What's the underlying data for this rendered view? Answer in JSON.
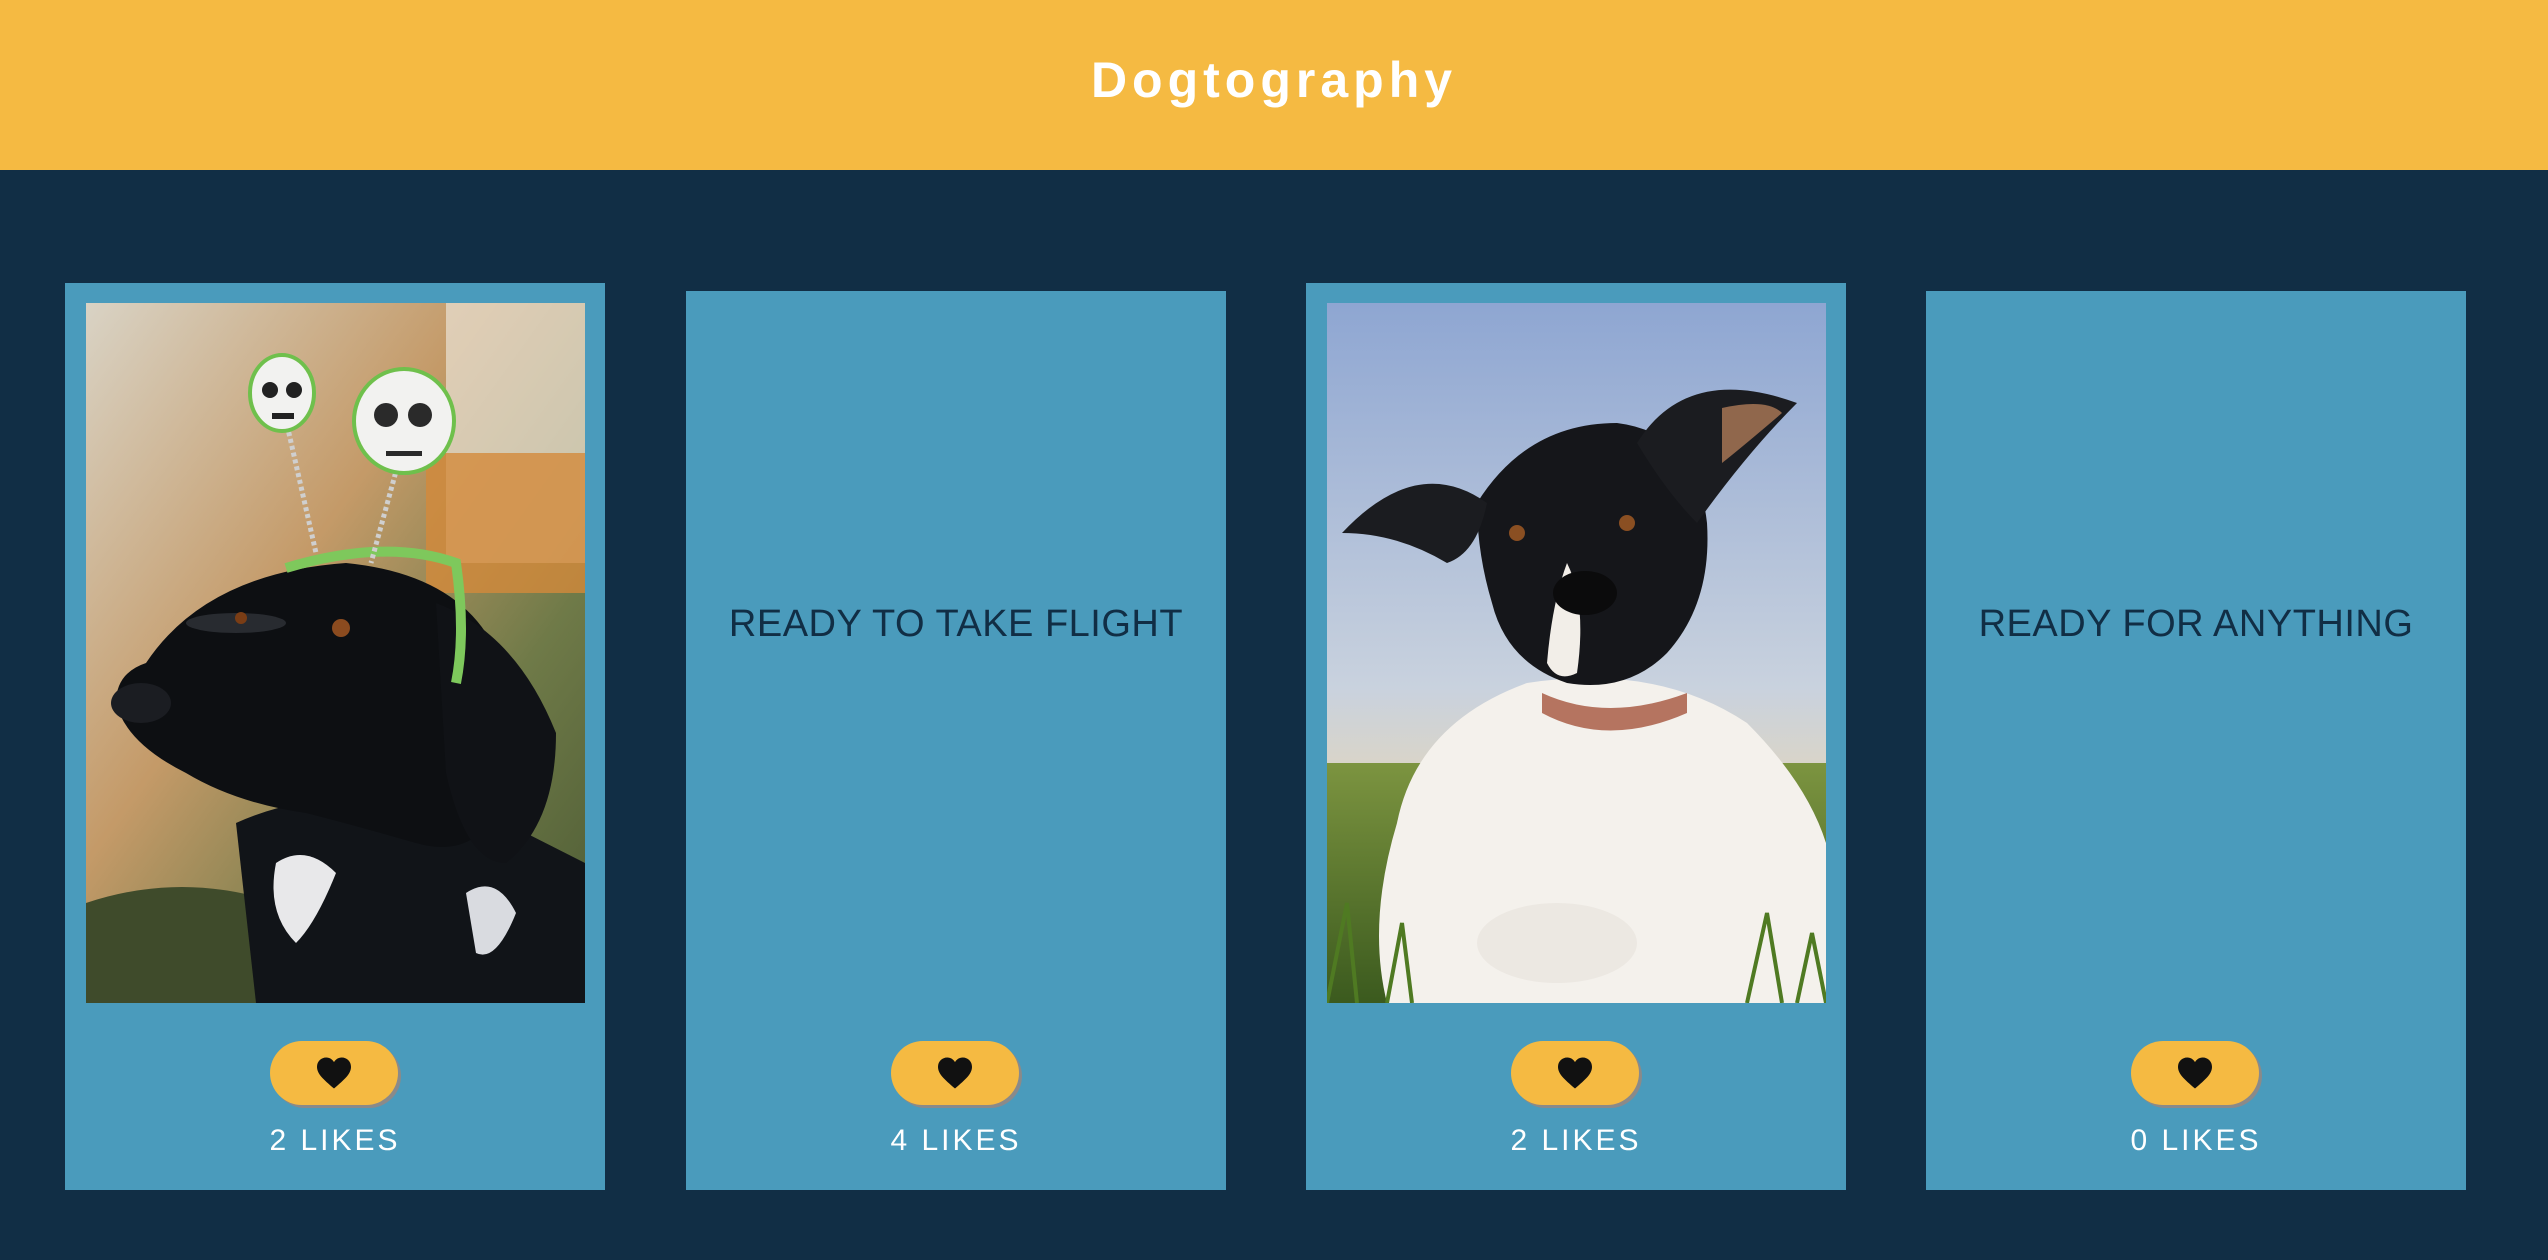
{
  "header": {
    "title": "Dogtography",
    "background_color": "#f5ba42"
  },
  "colors": {
    "page_background": "#112e45",
    "card_background": "#4a9bbc",
    "button_background": "#f5ba42",
    "caption_text": "#112e45",
    "likes_text": "#ffffff"
  },
  "cards": [
    {
      "type": "photo",
      "image": "black-dog-skull-headband",
      "heart_icon": "black-heart-icon",
      "likes_label": "2 LIKES"
    },
    {
      "type": "caption",
      "caption": "READY TO TAKE FLIGHT",
      "heart_icon": "black-heart-icon",
      "likes_label": "4 LIKES"
    },
    {
      "type": "photo",
      "image": "black-white-dog-in-grass",
      "heart_icon": "black-heart-icon",
      "likes_label": "2 LIKES"
    },
    {
      "type": "caption",
      "caption": "READY FOR ANYTHING",
      "heart_icon": "black-heart-icon",
      "likes_label": "0 LIKES"
    }
  ]
}
